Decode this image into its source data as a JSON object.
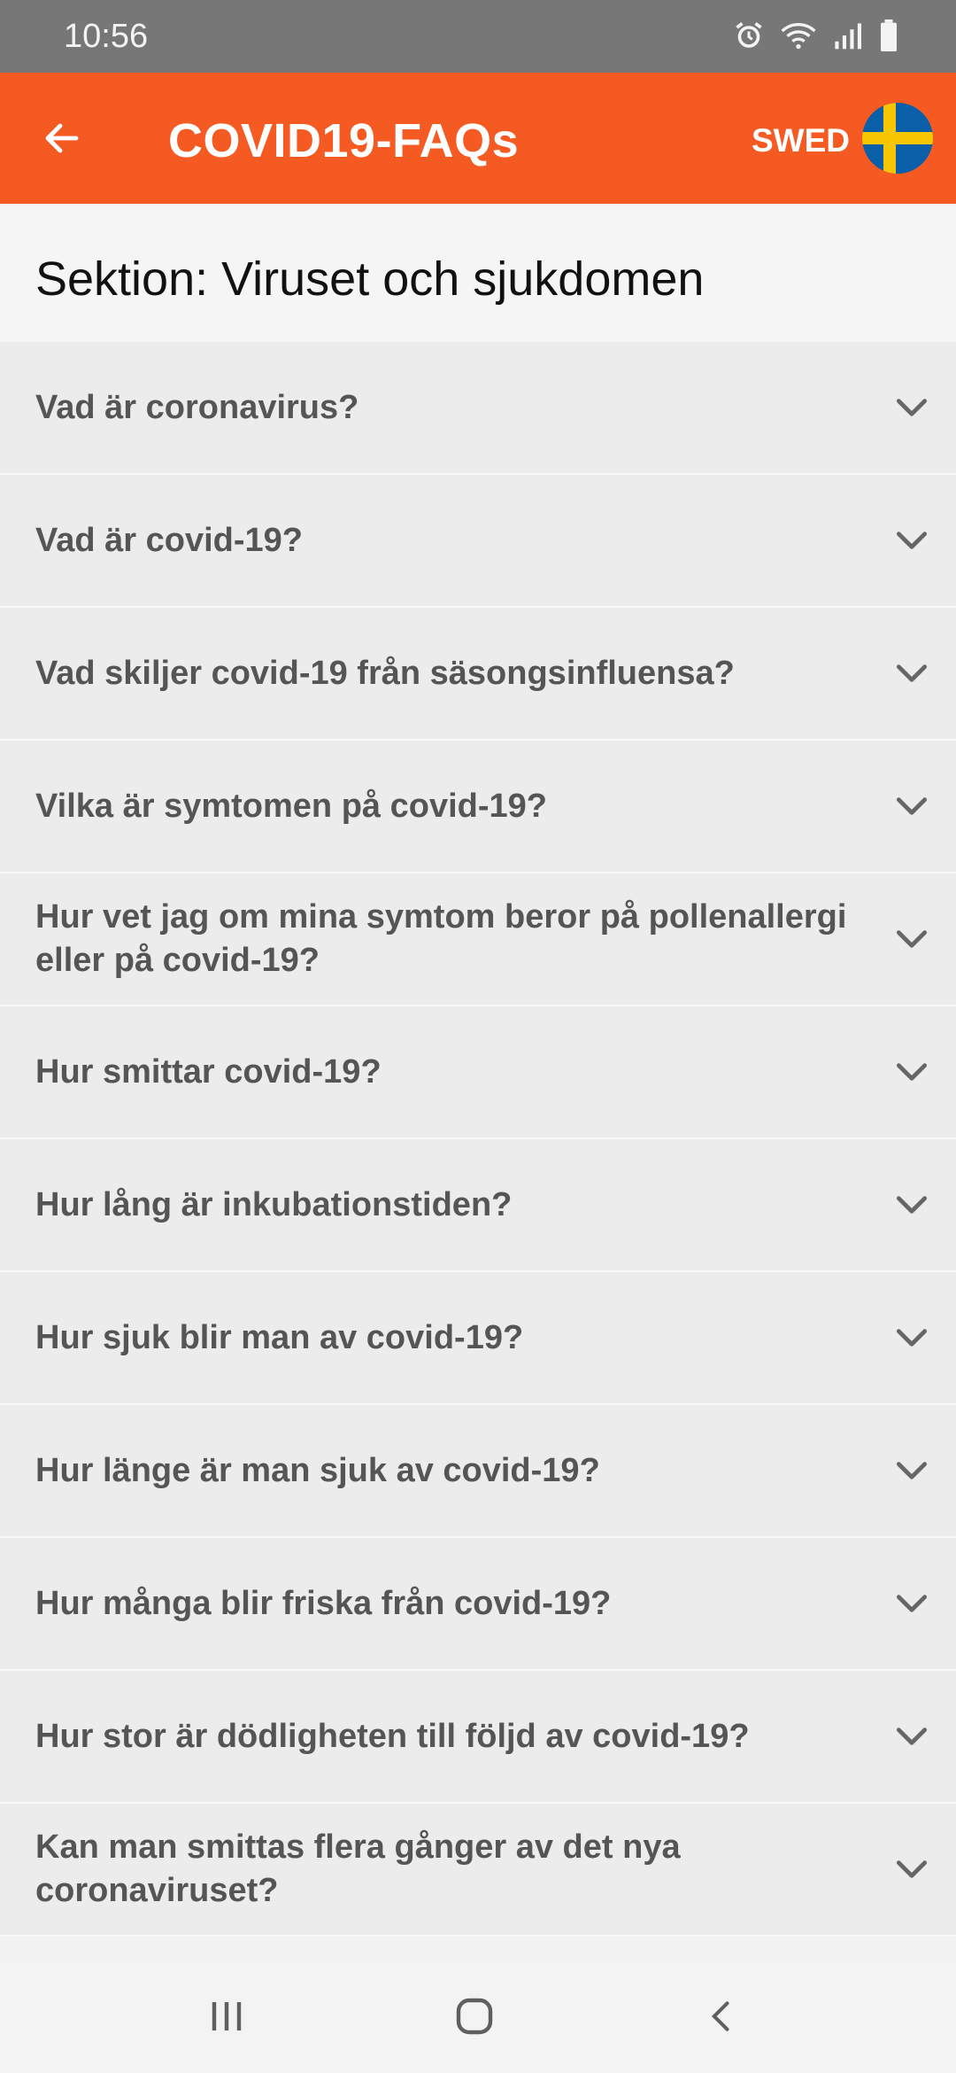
{
  "status": {
    "time": "10:56"
  },
  "appbar": {
    "title": "COVID19-FAQs",
    "language": "SWED"
  },
  "section": {
    "title": "Sektion: Viruset och sjukdomen"
  },
  "faqs": [
    "Vad är coronavirus?",
    "Vad är covid-19?",
    "Vad skiljer covid-19 från säsongsinfluensa?",
    "Vilka är symtomen på covid-19?",
    "Hur vet jag om mina symtom beror på pollenallergi eller på covid-19?",
    "Hur smittar covid-19?",
    "Hur lång är inkubationstiden?",
    "Hur sjuk blir man av covid-19?",
    "Hur länge är man sjuk av covid-19?",
    "Hur många blir friska från covid-19?",
    "Hur stor är dödligheten till följd av covid-19?",
    "Kan man smittas flera gånger av det nya coronaviruset?"
  ],
  "colors": {
    "accent": "#f55a22",
    "flag_blue": "#0a5fa8",
    "flag_yellow": "#f7c600"
  },
  "icons": {
    "back": "arrow-left-icon",
    "expand": "chevron-down-icon"
  }
}
